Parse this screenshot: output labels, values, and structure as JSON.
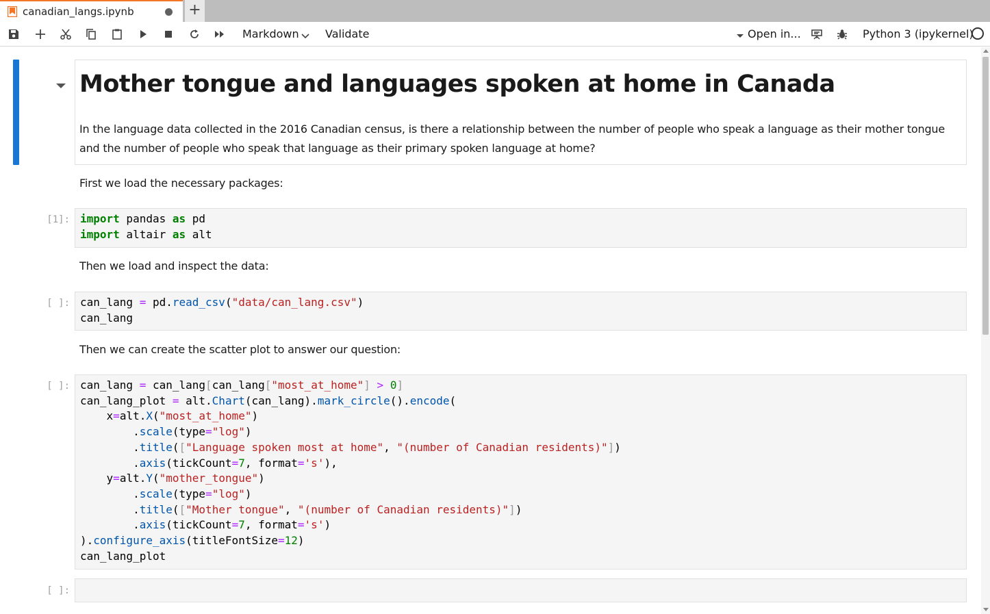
{
  "tab": {
    "filename": "canadian_langs.ipynb",
    "new_tab_label": "+"
  },
  "toolbar": {
    "cell_type": "Markdown",
    "validate_label": "Validate",
    "open_in_label": "Open in...",
    "kernel_name": "Python 3 (ipykernel)"
  },
  "colors": {
    "active_cell_bar": "#1976d2",
    "tab_accent": "#f37626",
    "code_background": "#f5f5f5"
  },
  "cells": {
    "heading": "Mother tongue and languages spoken at home in Canada",
    "intro_line1": "In the language data collected in the 2016 Canadian census, is there a relationship between the number of people who speak a language as their mother tongue",
    "intro_line2": "and the number of people who speak that language as their primary spoken language at home?",
    "md_load_packages": "First we load the necessary packages:",
    "prompt1": "[1]:",
    "md_load_data": "Then we load and inspect the data:",
    "prompt2": "[ ]:",
    "md_scatter": "Then we can create the scatter plot to answer our question:",
    "prompt3": "[ ]:",
    "prompt4": "[ ]:"
  }
}
